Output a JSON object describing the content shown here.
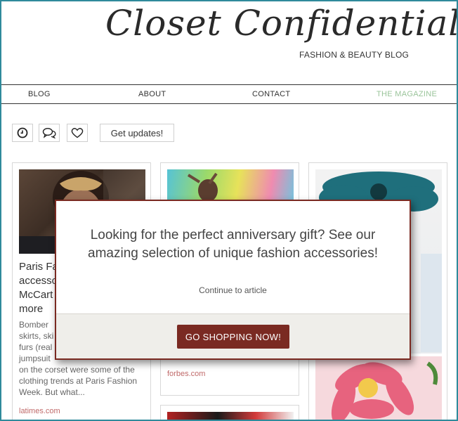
{
  "header": {
    "logo_title": "Closet Confidential",
    "logo_subtitle": "FASHION & BEAUTY BLOG"
  },
  "nav": {
    "items": [
      {
        "label": "BLOG",
        "color": "#333333"
      },
      {
        "label": "ABOUT",
        "color": "#333333"
      },
      {
        "label": "CONTACT",
        "color": "#333333"
      },
      {
        "label": "THE MAGAZINE",
        "color": "#9ac49a"
      }
    ]
  },
  "actions": {
    "icons": [
      "clock-icon",
      "comments-icon",
      "heart-icon"
    ],
    "get_updates_label": "Get updates!"
  },
  "cards": [
    {
      "title": "Paris Fa... accesso... McCart... more",
      "title_lines": [
        "Paris Fa",
        "accesso",
        "McCart",
        "more"
      ],
      "excerpt_lines": [
        "Bomber",
        "skirts, ski",
        "furs (real",
        "jumpsuit",
        "on the corset were some of the",
        "clothing trends at Paris Fashion",
        "Week. But what..."
      ],
      "source": "latimes.com"
    },
    {
      "title": "",
      "source": "forbes.com"
    },
    {
      "title": "",
      "source": ""
    }
  ],
  "modal": {
    "headline": "Looking for the perfect anniversary gift? See our amazing selection of unique fashion accessories!",
    "continue_label": "Continue to article",
    "cta_label": "GO SHOPPING NOW!"
  },
  "colors": {
    "accent": "#7a2a22",
    "frame": "#2f8a9b",
    "magazine_link": "#9ac49a",
    "source_link": "#c06a6a"
  }
}
